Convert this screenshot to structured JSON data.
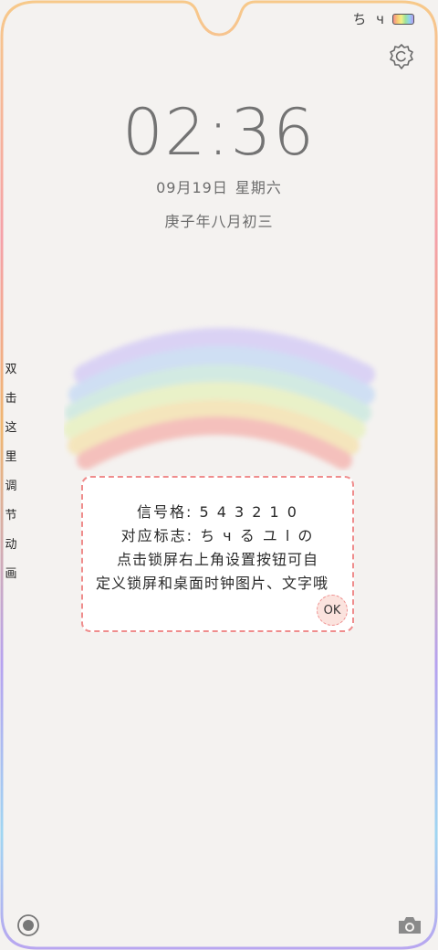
{
  "status_bar": {
    "signal_text": "ち ч",
    "battery_icon": "rainbow-battery-icon"
  },
  "settings": {
    "icon": "gear-icon"
  },
  "lockscreen": {
    "time": "02:36",
    "date": "09月19日",
    "weekday": "星期六",
    "lunar_date": "庚子年八月初三"
  },
  "side_hint": {
    "chars": [
      "双",
      "击",
      "这",
      "里",
      "调",
      "节",
      "动",
      "画"
    ]
  },
  "notice": {
    "line1": "信号格: 5 4 3 2 1 0",
    "line2": "对应标志: ち ч る ユ l の",
    "line3": "点击锁屏右上角设置按钮可自",
    "line4": "定义锁屏和桌面时钟图片、文字哦",
    "ok_label": "OK"
  },
  "bottom": {
    "left_icon": "circle-icon",
    "right_icon": "camera-icon"
  },
  "colors": {
    "frame_gradient": [
      "#f8c27f",
      "#f59d9d",
      "#b6a2f0",
      "#9fd6f2",
      "#a6e6a7"
    ],
    "notice_border": "#ef8d8d",
    "background": "#f4f2f0"
  }
}
